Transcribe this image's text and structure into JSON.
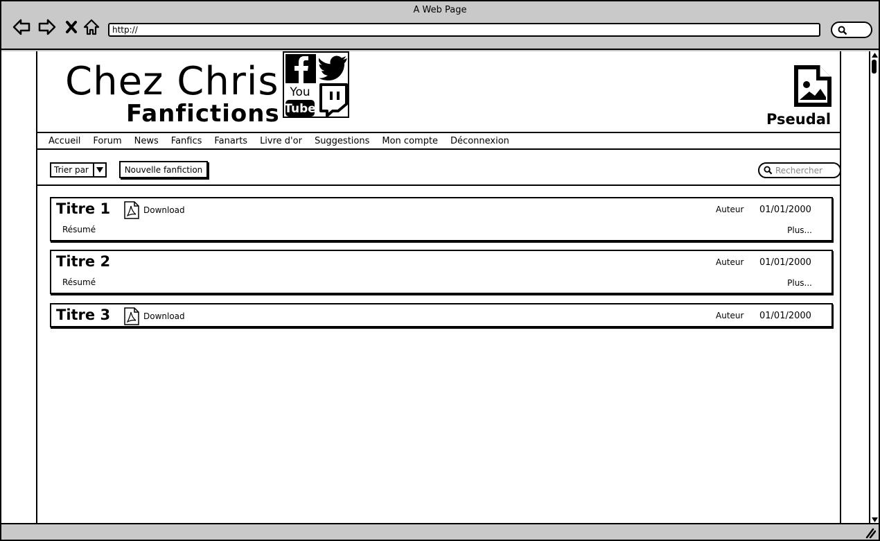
{
  "browser": {
    "title": "A Web Page",
    "url": "http://"
  },
  "header": {
    "site_title_line1": "Chez Chris",
    "site_title_line2": "Fanfictions",
    "social_icons": [
      "facebook-icon",
      "twitter-icon",
      "youtube-icon",
      "twitch-icon"
    ],
    "youtube_text_top": "You",
    "youtube_text_bottom": "Tube",
    "profile_name": "Pseudal"
  },
  "menu": {
    "items": [
      "Accueil",
      "Forum",
      "News",
      "Fanfics",
      "Fanarts",
      "Livre d'or",
      "Suggestions",
      "Mon compte",
      "Déconnexion"
    ]
  },
  "toolbar": {
    "sort_label": "Trier par",
    "new_label": "Nouvelle fanfiction",
    "search_placeholder": "Rechercher"
  },
  "fanfics": [
    {
      "title": "Titre 1",
      "download": "Download",
      "author": "Auteur",
      "date": "01/01/2000",
      "summary": "Résumé",
      "more": "Plus..."
    },
    {
      "title": "Titre 2",
      "download": "",
      "author": "Auteur",
      "date": "01/01/2000",
      "summary": "Résumé",
      "more": "Plus..."
    },
    {
      "title": "Titre 3",
      "download": "Download",
      "author": "Auteur",
      "date": "01/01/2000",
      "summary": "",
      "more": ""
    }
  ]
}
